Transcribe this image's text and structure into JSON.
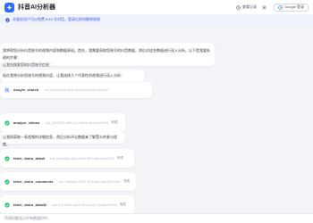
{
  "header": {
    "title": "抖音AI分析器",
    "history_label": "查看记录",
    "google_label": "Google 登录"
  },
  "notice": {
    "text": "本服务用户可以免费 5/10 次对话，登录后即刻解除限制"
  },
  "messages": {
    "intro": "我将帮您分析抖音账号的视频内容和数据表现。首先，我需要获取您账号的抖音数据，然后对这些数据进行深入分析。以下是我要处理的步骤：",
    "intro_line2": "让我先搜索您的抖音账号信息：",
    "after_search": "现在我将分析您账号的视频内容，让我选择几个代表性的视频进行深入分析：",
    "after_analysis": "让我再获取一条视频的详细信息，然后分析评论数据来了解受众的参与程度。"
  },
  "tools": [
    {
      "name": "douyin_search",
      "id": "call_cb51a14a6-f3b8-4d4f-91b0-a4f2c7ba91e7",
      "status": "完成"
    },
    {
      "name": "analyze_videos",
      "id": "call_12b9f534-d9f8-4c41-8e33-4ba3bb2f9164",
      "status": "完成"
    },
    {
      "name": "fetch_video_detail",
      "id": "call_f4a5d2a4-4b1a-4b2e-b87a-af2d19cc7d20",
      "status": "完成"
    },
    {
      "name": "fetch_video_comments",
      "id": "call_49d6faa0-1b42-4e7f-8f3c-d5c2b2c7f9a2",
      "status": "完成"
    },
    {
      "name": "fetch_video_detail2",
      "id": "call_b7d1c02e-5a22-4b7a-b3d1-7e0a5c9f1b3d",
      "status": "完成"
    }
  ],
  "input": {
    "placeholder": "声明问题显示中有数据时中..."
  },
  "colors": {
    "accent": "#2f6bff",
    "notice_bg": "#eef3ff"
  }
}
